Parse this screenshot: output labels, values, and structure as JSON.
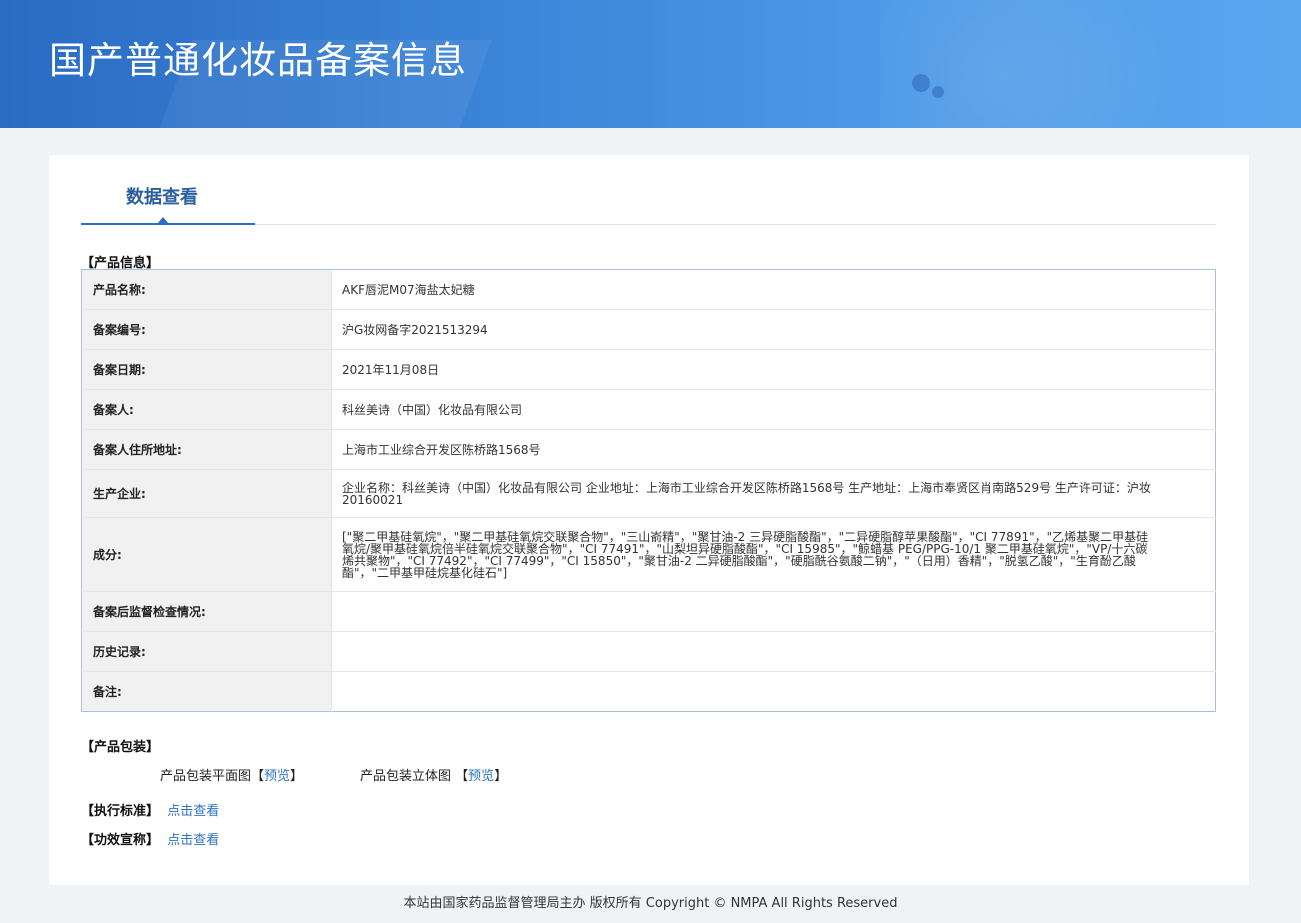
{
  "header": {
    "title": "国产普通化妆品备案信息"
  },
  "tab": {
    "label": "数据查看"
  },
  "sections": {
    "product_info": "【产品信息】",
    "packaging": "【产品包装】",
    "standard": "【执行标准】",
    "efficacy": "【功效宣称】"
  },
  "info_rows": [
    {
      "label": "产品名称:",
      "value": "AKF唇泥M07海盐太妃糖"
    },
    {
      "label": "备案编号:",
      "value": "沪G妆网备字2021513294"
    },
    {
      "label": "备案日期:",
      "value": "2021年11月08日"
    },
    {
      "label": "备案人:",
      "value": "科丝美诗（中国）化妆品有限公司"
    },
    {
      "label": "备案人住所地址:",
      "value": "上海市工业综合开发区陈桥路1568号"
    },
    {
      "label": "生产企业:",
      "value": "企业名称：科丝美诗（中国）化妆品有限公司 企业地址：上海市工业综合开发区陈桥路1568号 生产地址：上海市奉贤区肖南路529号 生产许可证：沪妆20160021"
    },
    {
      "label": "成分:",
      "value": "[\"聚二甲基硅氧烷\"，\"聚二甲基硅氧烷交联聚合物\"，\"三山嵛精\"，\"聚甘油-2 三异硬脂酸酯\"，\"二异硬脂醇苹果酸酯\"，\"CI 77891\"，\"乙烯基聚二甲基硅氧烷/聚甲基硅氧烷倍半硅氧烷交联聚合物\"，\"CI 77491\"，\"山梨坦异硬脂酸酯\"，\"CI 15985\"，\"鲸蜡基 PEG/PPG-10/1 聚二甲基硅氧烷\"，\"VP/十六碳烯共聚物\"，\"CI 77492\"，\"CI 77499\"，\"CI 15850\"，\"聚甘油-2 二异硬脂酸酯\"，\"硬脂酰谷氨酸二钠\"，\"（日用）香精\"，\"脱氢乙酸\"，\"生育酚乙酸酯\"，\"二甲基甲硅烷基化硅石\"]"
    },
    {
      "label": "备案后监督检查情况:",
      "value": ""
    },
    {
      "label": "历史记录:",
      "value": ""
    },
    {
      "label": "备注:",
      "value": ""
    }
  ],
  "packaging": {
    "flat_label": "产品包装平面图",
    "flat_link": "预览",
    "solid_label": "产品包装立体图",
    "solid_link": "预览",
    "bracket_open": "【",
    "bracket_close": "】"
  },
  "standard_link": "点击查看",
  "efficacy_link": "点击查看",
  "footer": {
    "text": "本站由国家药品监督管理局主办 版权所有 Copyright © NMPA All Rights Reserved"
  }
}
